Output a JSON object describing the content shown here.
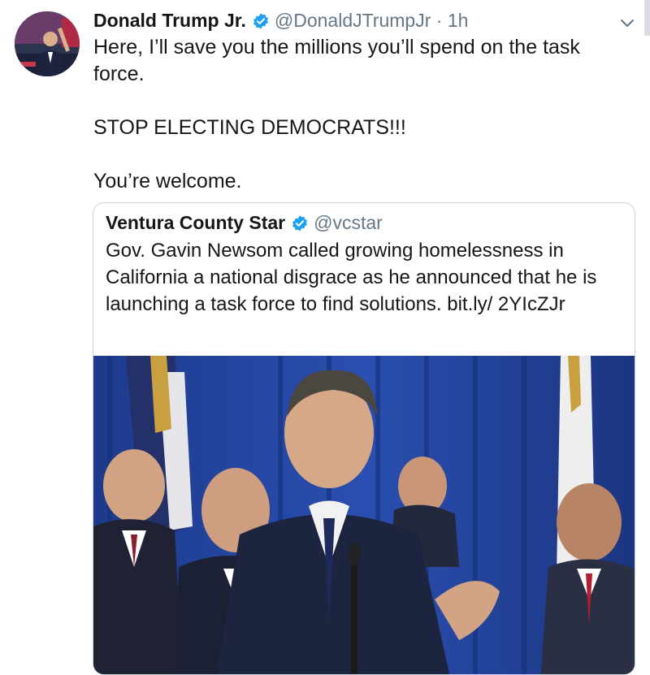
{
  "tweet": {
    "author_name": "Donald Trump Jr.",
    "handle": "@DonaldJTrumpJr",
    "separator": "·",
    "time": "1h",
    "lines": [
      "Here, I’ll save you the millions you’ll spend on the task force.",
      "",
      "STOP ELECTING DEMOCRATS!!!",
      "",
      "You’re welcome."
    ]
  },
  "quoted_tweet": {
    "author_name": "Ventura County Star",
    "handle": "@vcstar",
    "text": "Gov. Gavin Newsom called growing homelessness in California a national disgrace as he announced that he is launching a task force to find solutions. bit.ly/ 2YIcZJr"
  },
  "icons": {
    "verified": "verified-badge-icon",
    "caret": "chevron-down-icon"
  },
  "colors": {
    "verified_blue": "#1da1f2",
    "secondary_text": "#657786",
    "border": "#ccd6dd"
  }
}
